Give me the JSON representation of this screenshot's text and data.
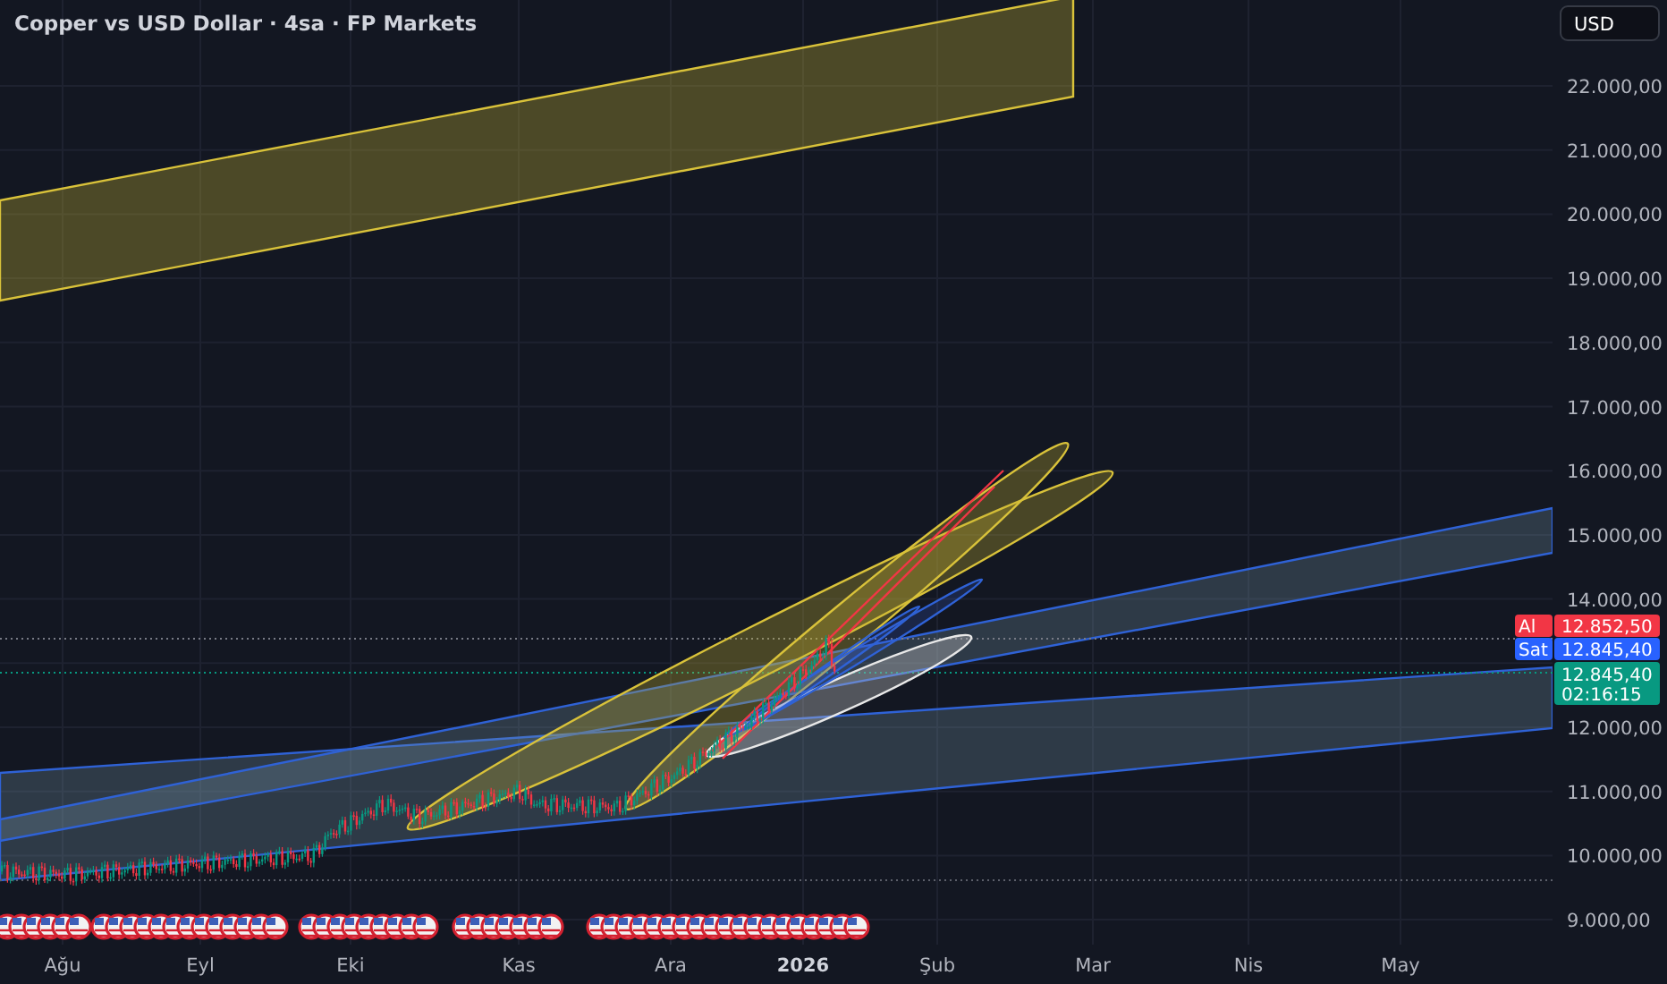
{
  "title": "Copper vs USD Dollar · 4sa · FP Markets",
  "currency_button": "USD",
  "price_axis": [
    "22.000,00",
    "21.000,00",
    "20.000,00",
    "19.000,00",
    "18.000,00",
    "17.000,00",
    "16.000,00",
    "15.000,00",
    "14.000,00",
    "12.000,00",
    "11.000,00",
    "10.000,00",
    "9.000,00"
  ],
  "price_tags": [
    {
      "kind": "order",
      "label": "Al",
      "value": "12.852,50",
      "color": "#f23645"
    },
    {
      "kind": "order",
      "label": "Sat",
      "value": "12.845,40",
      "color": "#2962ff"
    },
    {
      "kind": "last",
      "value": "12.845,40",
      "countdown": "02:16:15",
      "color": "#089981"
    }
  ],
  "time_axis": [
    {
      "kind": "month",
      "label": "Ağu"
    },
    {
      "kind": "month",
      "label": "Eyl"
    },
    {
      "kind": "month",
      "label": "Eki"
    },
    {
      "kind": "month",
      "label": "Kas"
    },
    {
      "kind": "month",
      "label": "Ara"
    },
    {
      "kind": "year",
      "label": "2026"
    },
    {
      "kind": "month",
      "label": "Şub"
    },
    {
      "kind": "month",
      "label": "Mar"
    },
    {
      "kind": "month",
      "label": "Nis"
    },
    {
      "kind": "month",
      "label": "May"
    }
  ]
}
